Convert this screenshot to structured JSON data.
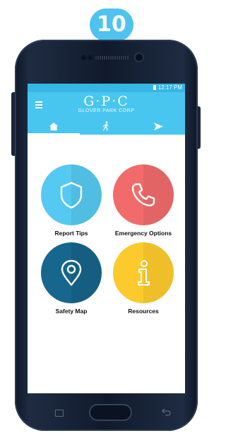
{
  "step_badge": "10",
  "status_bar": {
    "time": "12:17 PM"
  },
  "header": {
    "logo": "G·P·C",
    "subtitle": "GLOVER PARK CORP"
  },
  "tabs": [
    {
      "icon": "home-icon",
      "active": true
    },
    {
      "icon": "walking-person-icon",
      "active": false
    },
    {
      "icon": "navigation-arrow-icon",
      "active": false
    }
  ],
  "tiles": [
    {
      "label": "Report Tips",
      "icon": "shield-icon",
      "color": "#55c9f2"
    },
    {
      "label": "Emergency Options",
      "icon": "phone-icon",
      "color": "#f26b6b"
    },
    {
      "label": "Safety Map",
      "icon": "location-pin-icon",
      "color": "#17668e"
    },
    {
      "label": "Resources",
      "icon": "info-icon",
      "color": "#fcca2c"
    }
  ],
  "colors": {
    "accent": "#48c6f0",
    "badge": "#4fc3f0",
    "phone_body": "#131d2e"
  }
}
